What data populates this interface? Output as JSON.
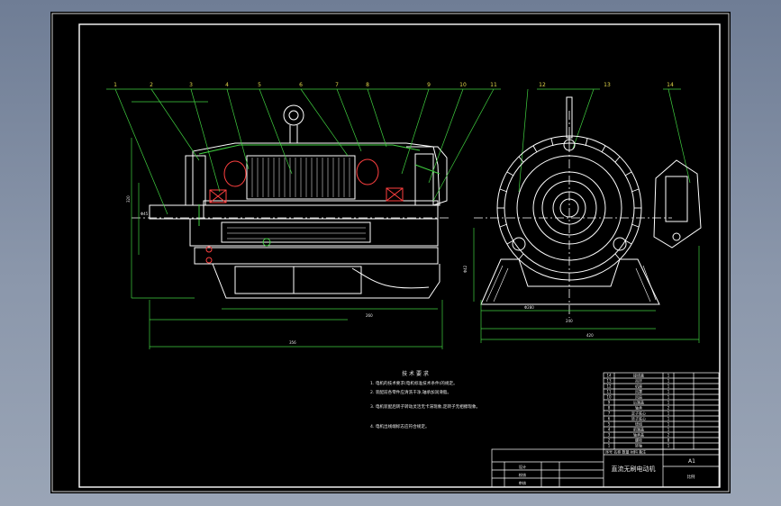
{
  "drawing": {
    "part_labels": [
      "1",
      "2",
      "3",
      "4",
      "5",
      "6",
      "7",
      "8",
      "9",
      "10",
      "11",
      "12",
      "13",
      "14"
    ],
    "tech_requirements": {
      "heading": "技 术 要 求",
      "lines": [
        "1. 电机的技术要求(电机标准技术条件)的规定。",
        "2. 装配前各零件应清洗干净,轴承加润滑脂。",
        "3. 电机装配后转子转动灵活无卡滞现象,定转子无相擦现象。",
        "4. 电机出线端标志应符合规定。"
      ]
    },
    "bom_rows": [
      {
        "no": "14",
        "name": "接线盒",
        "qty": "1"
      },
      {
        "no": "13",
        "name": "吊环",
        "qty": "1"
      },
      {
        "no": "12",
        "name": "机座",
        "qty": "1"
      },
      {
        "no": "11",
        "name": "风罩",
        "qty": "1"
      },
      {
        "no": "10",
        "name": "风扇",
        "qty": "1"
      },
      {
        "no": "9",
        "name": "后端盖",
        "qty": "1"
      },
      {
        "no": "8",
        "name": "轴承",
        "qty": "2"
      },
      {
        "no": "7",
        "name": "定子铁心",
        "qty": "1"
      },
      {
        "no": "6",
        "name": "转子铁心",
        "qty": "1"
      },
      {
        "no": "5",
        "name": "绕组",
        "qty": "1"
      },
      {
        "no": "4",
        "name": "前端盖",
        "qty": "1"
      },
      {
        "no": "3",
        "name": "轴承盖",
        "qty": "2"
      },
      {
        "no": "2",
        "name": "螺栓",
        "qty": "8"
      },
      {
        "no": "1",
        "name": "转轴",
        "qty": "1"
      }
    ],
    "title_block": {
      "title": "直流无刷电动机",
      "sheet_size": "A1",
      "header": "序号 名称 数量 材料 备注",
      "drawer_rows": [
        "设计",
        "校核",
        "审核"
      ],
      "date_box": "比例"
    },
    "dimension_texts": [
      "Φ45",
      "Φ42",
      "Φ280",
      "240",
      "320",
      "356",
      "260",
      "420"
    ]
  }
}
